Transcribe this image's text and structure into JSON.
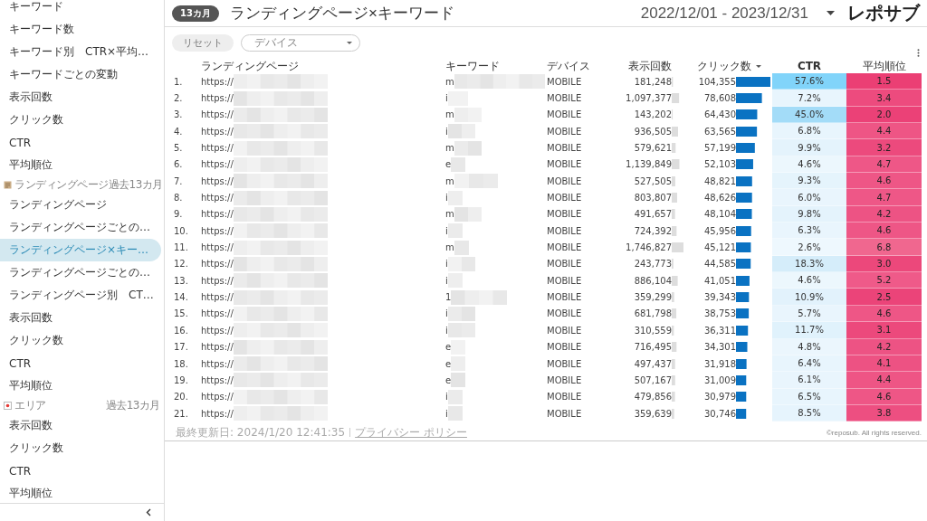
{
  "sidebar": {
    "items": [
      {
        "kind": "item",
        "label": "キーワード",
        "selected": false
      },
      {
        "kind": "item",
        "label": "キーワード数",
        "selected": false
      },
      {
        "kind": "item",
        "label": "キーワード別　CTR×平均…",
        "selected": false
      },
      {
        "kind": "item",
        "label": "キーワードごとの変動",
        "selected": false
      },
      {
        "kind": "item",
        "label": "表示回数",
        "selected": false
      },
      {
        "kind": "item",
        "label": "クリック数",
        "selected": false
      },
      {
        "kind": "item",
        "label": "CTR",
        "selected": false
      },
      {
        "kind": "item",
        "label": "平均順位",
        "selected": false
      },
      {
        "kind": "section",
        "label": "ランディングページ",
        "note": "過去13カ月"
      },
      {
        "kind": "item",
        "label": "ランディングページ",
        "selected": false
      },
      {
        "kind": "item",
        "label": "ランディングページごとの…",
        "selected": false
      },
      {
        "kind": "item",
        "label": "ランディングページ×キー…",
        "selected": true
      },
      {
        "kind": "item",
        "label": "ランディングページごとの…",
        "selected": false
      },
      {
        "kind": "item",
        "label": "ランディングページ別　CT…",
        "selected": false
      },
      {
        "kind": "item",
        "label": "表示回数",
        "selected": false
      },
      {
        "kind": "item",
        "label": "クリック数",
        "selected": false
      },
      {
        "kind": "item",
        "label": "CTR",
        "selected": false
      },
      {
        "kind": "item",
        "label": "平均順位",
        "selected": false
      },
      {
        "kind": "section",
        "label": "エリア",
        "note": "過去13カ月"
      },
      {
        "kind": "item",
        "label": "表示回数",
        "selected": false
      },
      {
        "kind": "item",
        "label": "クリック数",
        "selected": false
      },
      {
        "kind": "item",
        "label": "CTR",
        "selected": false
      },
      {
        "kind": "item",
        "label": "平均順位",
        "selected": false
      }
    ]
  },
  "header": {
    "badge": "13カ月",
    "title": "ランディングページ×キーワード",
    "date_range": "2022/12/01 - 2023/12/31",
    "logo": "レポサブ"
  },
  "filters": {
    "reset": "リセット",
    "device": {
      "placeholder": "デバイス"
    }
  },
  "table": {
    "columns": [
      {
        "label": "ランディングページ",
        "sorted": false
      },
      {
        "label": "キーワード",
        "sorted": false
      },
      {
        "label": "デバイス",
        "sorted": false
      },
      {
        "label": "表示回数",
        "sorted": false
      },
      {
        "label": "クリック数",
        "sorted": true
      },
      {
        "label": "CTR",
        "sorted": false
      },
      {
        "label": "平均順位",
        "sorted": false
      }
    ],
    "rows": [
      {
        "index": "1.",
        "url": "https://",
        "keyword": "m",
        "device": "MOBILE",
        "impressions": {
          "text": "181,248",
          "level": 0.104
        },
        "clicks": {
          "text": "104,355",
          "level": 1
        },
        "ctr": {
          "text": "57.6%",
          "color": "#81d4fa"
        },
        "rank": {
          "text": "1.5",
          "color": "#eb3f74"
        }
      },
      {
        "index": "2.",
        "url": "https://",
        "keyword": "i",
        "device": "MOBILE",
        "impressions": {
          "text": "1,097,377",
          "level": 0.628
        },
        "clicks": {
          "text": "78,608",
          "level": 0.753
        },
        "ctr": {
          "text": "7.2%",
          "color": "#e8f5fd"
        },
        "rank": {
          "text": "3.4",
          "color": "#ed4b7e"
        }
      },
      {
        "index": "3.",
        "url": "https://",
        "keyword": "m",
        "device": "MOBILE",
        "impressions": {
          "text": "143,202",
          "level": 0.082
        },
        "clicks": {
          "text": "64,430",
          "level": 0.617
        },
        "ctr": {
          "text": "45.0%",
          "color": "#a3dcf8"
        },
        "rank": {
          "text": "2.0",
          "color": "#eb4177"
        }
      },
      {
        "index": "4.",
        "url": "https://",
        "keyword": "i",
        "device": "MOBILE",
        "impressions": {
          "text": "936,505",
          "level": 0.536
        },
        "clicks": {
          "text": "63,565",
          "level": 0.609
        },
        "ctr": {
          "text": "6.8%",
          "color": "#e8f5fd"
        },
        "rank": {
          "text": "4.4",
          "color": "#ee5585"
        }
      },
      {
        "index": "5.",
        "url": "https://",
        "keyword": "m",
        "device": "MOBILE",
        "impressions": {
          "text": "579,621",
          "level": 0.332
        },
        "clicks": {
          "text": "57,199",
          "level": 0.548
        },
        "ctr": {
          "text": "9.9%",
          "color": "#e4f3fc"
        },
        "rank": {
          "text": "3.2",
          "color": "#ec4a7d"
        }
      },
      {
        "index": "6.",
        "url": "https://",
        "keyword": "e",
        "device": "MOBILE",
        "impressions": {
          "text": "1,139,849",
          "level": 0.653
        },
        "clicks": {
          "text": "52,103",
          "level": 0.499
        },
        "ctr": {
          "text": "4.6%",
          "color": "#ecf7fd"
        },
        "rank": {
          "text": "4.7",
          "color": "#ee5787"
        }
      },
      {
        "index": "7.",
        "url": "https://",
        "keyword": "m",
        "device": "MOBILE",
        "impressions": {
          "text": "527,505",
          "level": 0.302
        },
        "clicks": {
          "text": "48,821",
          "level": 0.468
        },
        "ctr": {
          "text": "9.3%",
          "color": "#e5f4fc"
        },
        "rank": {
          "text": "4.6",
          "color": "#ee5686"
        }
      },
      {
        "index": "8.",
        "url": "https://",
        "keyword": "i",
        "device": "MOBILE",
        "impressions": {
          "text": "803,807",
          "level": 0.46
        },
        "clicks": {
          "text": "48,626",
          "level": 0.466
        },
        "ctr": {
          "text": "6.0%",
          "color": "#e9f5fd"
        },
        "rank": {
          "text": "4.7",
          "color": "#ee5787"
        }
      },
      {
        "index": "9.",
        "url": "https://",
        "keyword": "m",
        "device": "MOBILE",
        "impressions": {
          "text": "491,657",
          "level": 0.281
        },
        "clicks": {
          "text": "48,104",
          "level": 0.461
        },
        "ctr": {
          "text": "9.8%",
          "color": "#e4f3fc"
        },
        "rank": {
          "text": "4.2",
          "color": "#ed5384"
        }
      },
      {
        "index": "10.",
        "url": "https://",
        "keyword": "i",
        "device": "MOBILE",
        "impressions": {
          "text": "724,392",
          "level": 0.415
        },
        "clicks": {
          "text": "45,956",
          "level": 0.44
        },
        "ctr": {
          "text": "6.3%",
          "color": "#e9f5fd"
        },
        "rank": {
          "text": "4.6",
          "color": "#ee5686"
        }
      },
      {
        "index": "11.",
        "url": "https://",
        "keyword": "m",
        "device": "MOBILE",
        "impressions": {
          "text": "1,746,827",
          "level": 1
        },
        "clicks": {
          "text": "45,121",
          "level": 0.432
        },
        "ctr": {
          "text": "2.6%",
          "color": "#eef8fe"
        },
        "rank": {
          "text": "6.8",
          "color": "#f0678f"
        }
      },
      {
        "index": "12.",
        "url": "https://",
        "keyword": "i",
        "device": "MOBILE",
        "impressions": {
          "text": "243,773",
          "level": 0.14
        },
        "clicks": {
          "text": "44,585",
          "level": 0.427
        },
        "ctr": {
          "text": "18.3%",
          "color": "#d5edfa"
        },
        "rank": {
          "text": "3.0",
          "color": "#ec487b"
        }
      },
      {
        "index": "13.",
        "url": "https://",
        "keyword": "i",
        "device": "MOBILE",
        "impressions": {
          "text": "886,104",
          "level": 0.507
        },
        "clicks": {
          "text": "41,051",
          "level": 0.393
        },
        "ctr": {
          "text": "4.6%",
          "color": "#ecf7fd"
        },
        "rank": {
          "text": "5.2",
          "color": "#ef5a89"
        }
      },
      {
        "index": "14.",
        "url": "https://",
        "keyword": "1",
        "device": "MOBILE",
        "impressions": {
          "text": "359,299",
          "level": 0.206
        },
        "clicks": {
          "text": "39,343",
          "level": 0.377
        },
        "ctr": {
          "text": "10.9%",
          "color": "#e2f2fc"
        },
        "rank": {
          "text": "2.5",
          "color": "#eb4479"
        }
      },
      {
        "index": "15.",
        "url": "https://",
        "keyword": "i",
        "device": "MOBILE",
        "impressions": {
          "text": "681,798",
          "level": 0.39
        },
        "clicks": {
          "text": "38,753",
          "level": 0.371
        },
        "ctr": {
          "text": "5.7%",
          "color": "#e9f5fd"
        },
        "rank": {
          "text": "4.6",
          "color": "#ee5686"
        }
      },
      {
        "index": "16.",
        "url": "https://",
        "keyword": "i",
        "device": "MOBILE",
        "impressions": {
          "text": "310,559",
          "level": 0.178
        },
        "clicks": {
          "text": "36,311",
          "level": 0.348
        },
        "ctr": {
          "text": "11.7%",
          "color": "#e0f2fc"
        },
        "rank": {
          "text": "3.1",
          "color": "#ec497c"
        }
      },
      {
        "index": "17.",
        "url": "https://",
        "keyword": "e",
        "device": "MOBILE",
        "impressions": {
          "text": "716,495",
          "level": 0.41
        },
        "clicks": {
          "text": "34,301",
          "level": 0.329
        },
        "ctr": {
          "text": "4.8%",
          "color": "#ebf6fd"
        },
        "rank": {
          "text": "4.2",
          "color": "#ed5384"
        }
      },
      {
        "index": "18.",
        "url": "https://",
        "keyword": "e",
        "device": "MOBILE",
        "impressions": {
          "text": "497,437",
          "level": 0.285
        },
        "clicks": {
          "text": "31,918",
          "level": 0.306
        },
        "ctr": {
          "text": "6.4%",
          "color": "#e8f5fd"
        },
        "rank": {
          "text": "4.1",
          "color": "#ed5283"
        }
      },
      {
        "index": "19.",
        "url": "https://",
        "keyword": "e",
        "device": "MOBILE",
        "impressions": {
          "text": "507,167",
          "level": 0.29
        },
        "clicks": {
          "text": "31,009",
          "level": 0.297
        },
        "ctr": {
          "text": "6.1%",
          "color": "#e9f5fd"
        },
        "rank": {
          "text": "4.4",
          "color": "#ee5585"
        }
      },
      {
        "index": "20.",
        "url": "https://",
        "keyword": "i",
        "device": "MOBILE",
        "impressions": {
          "text": "479,856",
          "level": 0.275
        },
        "clicks": {
          "text": "30,979",
          "level": 0.297
        },
        "ctr": {
          "text": "6.5%",
          "color": "#e8f5fd"
        },
        "rank": {
          "text": "4.6",
          "color": "#ee5686"
        }
      },
      {
        "index": "21.",
        "url": "https://",
        "keyword": "i",
        "device": "MOBILE",
        "impressions": {
          "text": "359,639",
          "level": 0.206
        },
        "clicks": {
          "text": "30,746",
          "level": 0.295
        },
        "ctr": {
          "text": "8.5%",
          "color": "#e6f4fd"
        },
        "rank": {
          "text": "3.8",
          "color": "#ed4f81"
        }
      }
    ]
  },
  "footer": {
    "updated": "最終更新日: 2024/1/20 12:41:35",
    "privacy_link": "プライバシー ポリシー",
    "copyright": "©reposub. All rights reserved."
  }
}
